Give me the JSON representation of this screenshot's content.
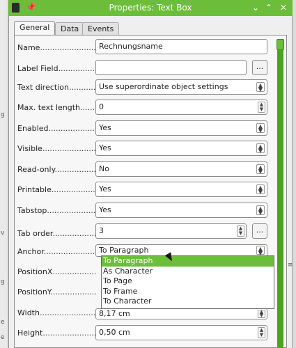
{
  "window": {
    "title": "Properties: Text Box",
    "controls": [
      "pin-icon",
      "chevron-down-icon",
      "chevron-up-icon",
      "close-icon"
    ]
  },
  "tabs": [
    {
      "label": "General",
      "active": true
    },
    {
      "label": "Data",
      "active": false
    },
    {
      "label": "Events",
      "active": false
    }
  ],
  "fields": {
    "name": {
      "label": "Name",
      "value": "Rechnungsname"
    },
    "label_field": {
      "label": "Label Field",
      "value": "",
      "button": "..."
    },
    "text_direction": {
      "label": "Text direction",
      "value": "Use superordinate object settings"
    },
    "max_text_length": {
      "label": "Max. text length",
      "value": "0"
    },
    "enabled": {
      "label": "Enabled",
      "value": "Yes"
    },
    "visible": {
      "label": "Visible",
      "value": "Yes"
    },
    "read_only": {
      "label": "Read-only",
      "value": "No"
    },
    "printable": {
      "label": "Printable",
      "value": "Yes"
    },
    "tabstop": {
      "label": "Tabstop",
      "value": "Yes"
    },
    "tab_order": {
      "label": "Tab order",
      "value": "3",
      "button": "..."
    },
    "anchor": {
      "label": "Anchor",
      "value": "To Paragraph"
    },
    "position_x": {
      "label": "PositionX"
    },
    "position_y": {
      "label": "PositionY"
    },
    "width": {
      "label": "Width",
      "value": "8,17 cm"
    },
    "height": {
      "label": "Height",
      "value": "0,50 cm"
    }
  },
  "anchor_dropdown": {
    "options": [
      "To Paragraph",
      "As Character",
      "To Page",
      "To Frame",
      "To Character"
    ],
    "selected": "To Paragraph"
  },
  "colors": {
    "accent": "#6cbe3a",
    "accent_dark": "#4da31e"
  }
}
